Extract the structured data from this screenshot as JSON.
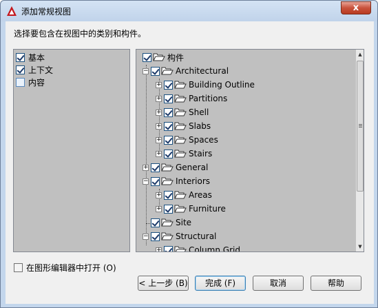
{
  "window": {
    "title": "添加常规视图",
    "close_label": "x"
  },
  "instruction": "选择要包含在视图中的类别和构件。",
  "categories": [
    {
      "label": "基本",
      "checked": true
    },
    {
      "label": "上下文",
      "checked": true
    },
    {
      "label": "内容",
      "checked": false
    }
  ],
  "tree": {
    "root": "构件",
    "architectural": "Architectural",
    "building_outline": "Building Outline",
    "partitions": "Partitions",
    "shell": "Shell",
    "slabs": "Slabs",
    "spaces": "Spaces",
    "stairs": "Stairs",
    "general": "General",
    "interiors": "Interiors",
    "areas": "Areas",
    "furniture": "Furniture",
    "site": "Site",
    "structural": "Structural",
    "column_grid": "Column Grid"
  },
  "open_in_editor": {
    "label": "在图形编辑器中打开 (O)",
    "checked": false
  },
  "buttons": {
    "back": "< 上一步 (B)",
    "finish": "完成 (F)",
    "cancel": "取消",
    "help": "帮助"
  },
  "colors": {
    "accent": "#3c7fb1",
    "app_icon": "#c4161c"
  }
}
